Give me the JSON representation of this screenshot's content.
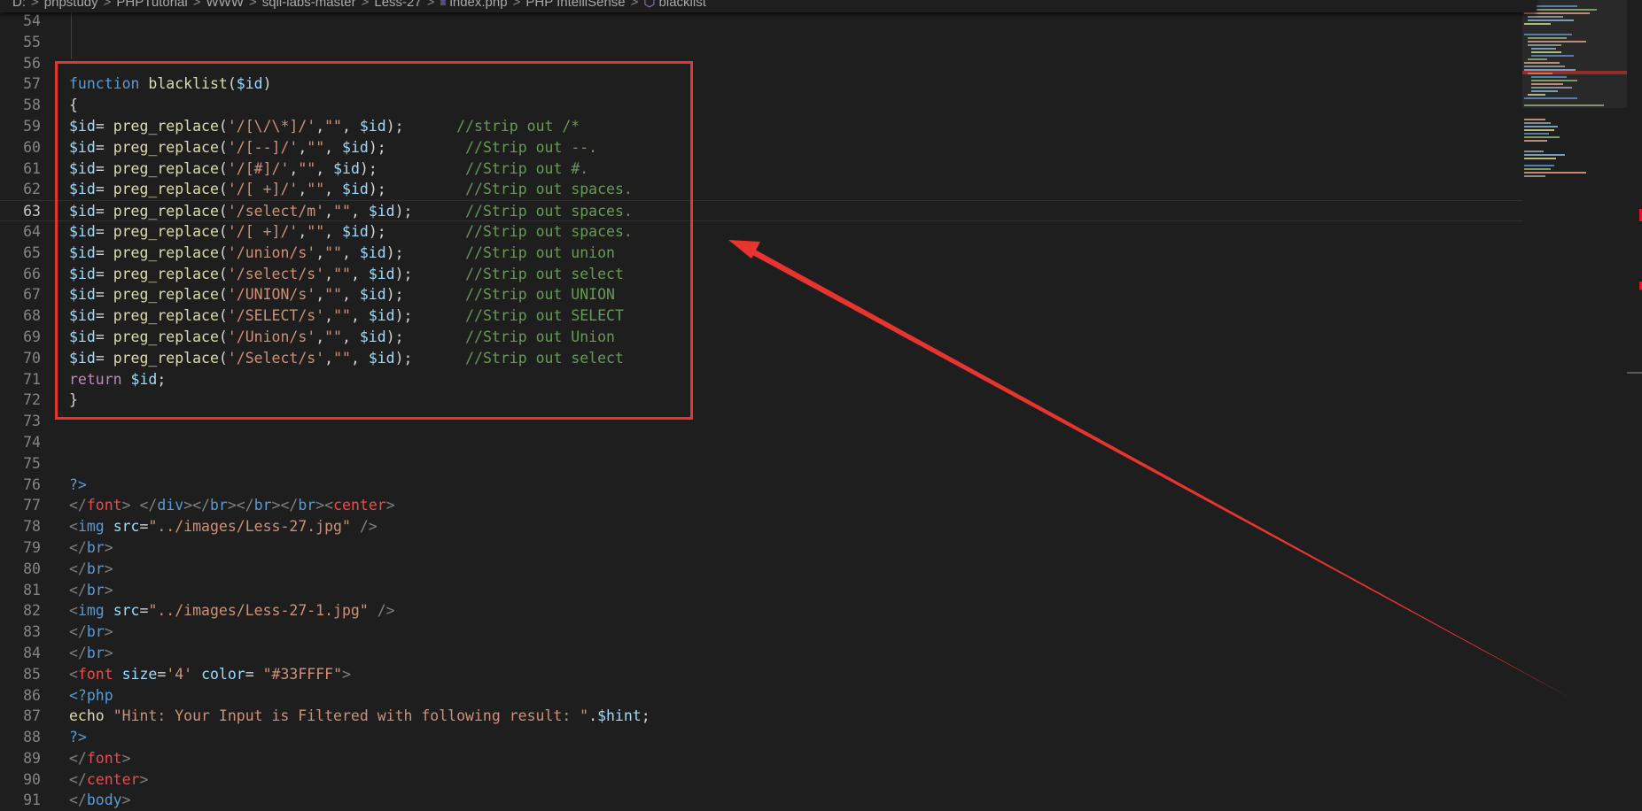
{
  "breadcrumb": {
    "items": [
      "D:",
      "phpstudy",
      "PHPTutorial",
      "WWW",
      "sqli-labs-master",
      "Less-27",
      "index.php",
      "PHP IntelliSense",
      "blacklist"
    ],
    "separator": ">"
  },
  "editor": {
    "current_line": 63,
    "lines": [
      {
        "n": "54",
        "t": []
      },
      {
        "n": "55",
        "t": []
      },
      {
        "n": "56",
        "t": []
      },
      {
        "n": "57",
        "t": [
          [
            "kw",
            "function"
          ],
          [
            "punc",
            " "
          ],
          [
            "fn",
            "blacklist"
          ],
          [
            "punc",
            "("
          ],
          [
            "var",
            "$id"
          ],
          [
            "punc",
            ")"
          ]
        ]
      },
      {
        "n": "58",
        "t": [
          [
            "punc",
            "{"
          ]
        ]
      },
      {
        "n": "59",
        "t": [
          [
            "var",
            "$id"
          ],
          [
            "punc",
            "= "
          ],
          [
            "fn",
            "preg_replace"
          ],
          [
            "punc",
            "("
          ],
          [
            "str",
            "'/[\\/\\*]/'"
          ],
          [
            "punc",
            ","
          ],
          [
            "str",
            "\"\""
          ],
          [
            "punc",
            ", "
          ],
          [
            "var",
            "$id"
          ],
          [
            "punc",
            ");      "
          ],
          [
            "cmt",
            "//strip out /*"
          ]
        ]
      },
      {
        "n": "60",
        "t": [
          [
            "var",
            "$id"
          ],
          [
            "punc",
            "= "
          ],
          [
            "fn",
            "preg_replace"
          ],
          [
            "punc",
            "("
          ],
          [
            "str",
            "'/[--]/'"
          ],
          [
            "punc",
            ","
          ],
          [
            "str",
            "\"\""
          ],
          [
            "punc",
            ", "
          ],
          [
            "var",
            "$id"
          ],
          [
            "punc",
            ");         "
          ],
          [
            "cmt",
            "//Strip out --."
          ]
        ]
      },
      {
        "n": "61",
        "t": [
          [
            "var",
            "$id"
          ],
          [
            "punc",
            "= "
          ],
          [
            "fn",
            "preg_replace"
          ],
          [
            "punc",
            "("
          ],
          [
            "str",
            "'/[#]/'"
          ],
          [
            "punc",
            ","
          ],
          [
            "str",
            "\"\""
          ],
          [
            "punc",
            ", "
          ],
          [
            "var",
            "$id"
          ],
          [
            "punc",
            ");          "
          ],
          [
            "cmt",
            "//Strip out #."
          ]
        ]
      },
      {
        "n": "62",
        "t": [
          [
            "var",
            "$id"
          ],
          [
            "punc",
            "= "
          ],
          [
            "fn",
            "preg_replace"
          ],
          [
            "punc",
            "("
          ],
          [
            "str",
            "'/[ +]/'"
          ],
          [
            "punc",
            ","
          ],
          [
            "str",
            "\"\""
          ],
          [
            "punc",
            ", "
          ],
          [
            "var",
            "$id"
          ],
          [
            "punc",
            ");         "
          ],
          [
            "cmt",
            "//Strip out spaces."
          ]
        ]
      },
      {
        "n": "63",
        "t": [
          [
            "var",
            "$id"
          ],
          [
            "punc",
            "= "
          ],
          [
            "fn",
            "preg_replace"
          ],
          [
            "punc",
            "("
          ],
          [
            "str",
            "'/select/m'"
          ],
          [
            "punc",
            ","
          ],
          [
            "str",
            "\"\""
          ],
          [
            "punc",
            ", "
          ],
          [
            "var",
            "$id"
          ],
          [
            "punc",
            ");      "
          ],
          [
            "cmt",
            "//Strip out spaces."
          ]
        ]
      },
      {
        "n": "64",
        "t": [
          [
            "var",
            "$id"
          ],
          [
            "punc",
            "= "
          ],
          [
            "fn",
            "preg_replace"
          ],
          [
            "punc",
            "("
          ],
          [
            "str",
            "'/[ +]/'"
          ],
          [
            "punc",
            ","
          ],
          [
            "str",
            "\"\""
          ],
          [
            "punc",
            ", "
          ],
          [
            "var",
            "$id"
          ],
          [
            "punc",
            ");         "
          ],
          [
            "cmt",
            "//Strip out spaces."
          ]
        ]
      },
      {
        "n": "65",
        "t": [
          [
            "var",
            "$id"
          ],
          [
            "punc",
            "= "
          ],
          [
            "fn",
            "preg_replace"
          ],
          [
            "punc",
            "("
          ],
          [
            "str",
            "'/union/s'"
          ],
          [
            "punc",
            ","
          ],
          [
            "str",
            "\"\""
          ],
          [
            "punc",
            ", "
          ],
          [
            "var",
            "$id"
          ],
          [
            "punc",
            ");       "
          ],
          [
            "cmt",
            "//Strip out union"
          ]
        ]
      },
      {
        "n": "66",
        "t": [
          [
            "var",
            "$id"
          ],
          [
            "punc",
            "= "
          ],
          [
            "fn",
            "preg_replace"
          ],
          [
            "punc",
            "("
          ],
          [
            "str",
            "'/select/s'"
          ],
          [
            "punc",
            ","
          ],
          [
            "str",
            "\"\""
          ],
          [
            "punc",
            ", "
          ],
          [
            "var",
            "$id"
          ],
          [
            "punc",
            ");      "
          ],
          [
            "cmt",
            "//Strip out select"
          ]
        ]
      },
      {
        "n": "67",
        "t": [
          [
            "var",
            "$id"
          ],
          [
            "punc",
            "= "
          ],
          [
            "fn",
            "preg_replace"
          ],
          [
            "punc",
            "("
          ],
          [
            "str",
            "'/UNION/s'"
          ],
          [
            "punc",
            ","
          ],
          [
            "str",
            "\"\""
          ],
          [
            "punc",
            ", "
          ],
          [
            "var",
            "$id"
          ],
          [
            "punc",
            ");       "
          ],
          [
            "cmt",
            "//Strip out UNION"
          ]
        ]
      },
      {
        "n": "68",
        "t": [
          [
            "var",
            "$id"
          ],
          [
            "punc",
            "= "
          ],
          [
            "fn",
            "preg_replace"
          ],
          [
            "punc",
            "("
          ],
          [
            "str",
            "'/SELECT/s'"
          ],
          [
            "punc",
            ","
          ],
          [
            "str",
            "\"\""
          ],
          [
            "punc",
            ", "
          ],
          [
            "var",
            "$id"
          ],
          [
            "punc",
            ");      "
          ],
          [
            "cmt",
            "//Strip out SELECT"
          ]
        ]
      },
      {
        "n": "69",
        "t": [
          [
            "var",
            "$id"
          ],
          [
            "punc",
            "= "
          ],
          [
            "fn",
            "preg_replace"
          ],
          [
            "punc",
            "("
          ],
          [
            "str",
            "'/Union/s'"
          ],
          [
            "punc",
            ","
          ],
          [
            "str",
            "\"\""
          ],
          [
            "punc",
            ", "
          ],
          [
            "var",
            "$id"
          ],
          [
            "punc",
            ");       "
          ],
          [
            "cmt",
            "//Strip out Union"
          ]
        ]
      },
      {
        "n": "70",
        "t": [
          [
            "var",
            "$id"
          ],
          [
            "punc",
            "= "
          ],
          [
            "fn",
            "preg_replace"
          ],
          [
            "punc",
            "("
          ],
          [
            "str",
            "'/Select/s'"
          ],
          [
            "punc",
            ","
          ],
          [
            "str",
            "\"\""
          ],
          [
            "punc",
            ", "
          ],
          [
            "var",
            "$id"
          ],
          [
            "punc",
            ");      "
          ],
          [
            "cmt",
            "//Strip out select"
          ]
        ]
      },
      {
        "n": "71",
        "t": [
          [
            "ctl",
            "return"
          ],
          [
            "punc",
            " "
          ],
          [
            "var",
            "$id"
          ],
          [
            "punc",
            ";"
          ]
        ]
      },
      {
        "n": "72",
        "t": [
          [
            "punc",
            "}"
          ]
        ]
      },
      {
        "n": "73",
        "t": []
      },
      {
        "n": "74",
        "t": []
      },
      {
        "n": "75",
        "t": []
      },
      {
        "n": "76",
        "t": [
          [
            "phptag",
            "?>"
          ]
        ]
      },
      {
        "n": "77",
        "t": [
          [
            "delim",
            "</"
          ],
          [
            "tname",
            "font"
          ],
          [
            "delim",
            ">"
          ],
          [
            "punc",
            " "
          ],
          [
            "delim",
            "</"
          ],
          [
            "tname2",
            "div"
          ],
          [
            "delim",
            "></"
          ],
          [
            "tname2",
            "br"
          ],
          [
            "delim",
            "></"
          ],
          [
            "tname2",
            "br"
          ],
          [
            "delim",
            "></"
          ],
          [
            "tname2",
            "br"
          ],
          [
            "delim",
            "><"
          ],
          [
            "tname",
            "center"
          ],
          [
            "delim",
            ">"
          ]
        ]
      },
      {
        "n": "78",
        "t": [
          [
            "delim",
            "<"
          ],
          [
            "tname2",
            "img"
          ],
          [
            "punc",
            " "
          ],
          [
            "attr",
            "src"
          ],
          [
            "punc",
            "="
          ],
          [
            "str",
            "\"../images/Less-27.jpg\""
          ],
          [
            "punc",
            " "
          ],
          [
            "delim",
            "/>"
          ]
        ]
      },
      {
        "n": "79",
        "t": [
          [
            "delim",
            "</"
          ],
          [
            "tname2",
            "br"
          ],
          [
            "delim",
            ">"
          ]
        ]
      },
      {
        "n": "80",
        "t": [
          [
            "delim",
            "</"
          ],
          [
            "tname2",
            "br"
          ],
          [
            "delim",
            ">"
          ]
        ]
      },
      {
        "n": "81",
        "t": [
          [
            "delim",
            "</"
          ],
          [
            "tname2",
            "br"
          ],
          [
            "delim",
            ">"
          ]
        ]
      },
      {
        "n": "82",
        "t": [
          [
            "delim",
            "<"
          ],
          [
            "tname2",
            "img"
          ],
          [
            "punc",
            " "
          ],
          [
            "attr",
            "src"
          ],
          [
            "punc",
            "="
          ],
          [
            "str",
            "\"../images/Less-27-1.jpg\""
          ],
          [
            "punc",
            " "
          ],
          [
            "delim",
            "/>"
          ]
        ]
      },
      {
        "n": "83",
        "t": [
          [
            "delim",
            "</"
          ],
          [
            "tname2",
            "br"
          ],
          [
            "delim",
            ">"
          ]
        ]
      },
      {
        "n": "84",
        "t": [
          [
            "delim",
            "</"
          ],
          [
            "tname2",
            "br"
          ],
          [
            "delim",
            ">"
          ]
        ]
      },
      {
        "n": "85",
        "t": [
          [
            "delim",
            "<"
          ],
          [
            "tname",
            "font"
          ],
          [
            "punc",
            " "
          ],
          [
            "attr",
            "size"
          ],
          [
            "punc",
            "="
          ],
          [
            "str",
            "'4'"
          ],
          [
            "punc",
            " "
          ],
          [
            "attr",
            "color"
          ],
          [
            "punc",
            "= "
          ],
          [
            "str",
            "\"#33FFFF\""
          ],
          [
            "delim",
            ">"
          ]
        ]
      },
      {
        "n": "86",
        "t": [
          [
            "phptag",
            "<?php"
          ]
        ]
      },
      {
        "n": "87",
        "t": [
          [
            "fn",
            "echo"
          ],
          [
            "punc",
            " "
          ],
          [
            "str",
            "\"Hint: Your Input is Filtered with following result: \""
          ],
          [
            "punc",
            "."
          ],
          [
            "var",
            "$hint"
          ],
          [
            "punc",
            ";"
          ]
        ]
      },
      {
        "n": "88",
        "t": [
          [
            "phptag",
            "?>"
          ]
        ]
      },
      {
        "n": "89",
        "t": [
          [
            "delim",
            "</"
          ],
          [
            "tname",
            "font"
          ],
          [
            "delim",
            ">"
          ]
        ]
      },
      {
        "n": "90",
        "t": [
          [
            "delim",
            "</"
          ],
          [
            "tname",
            "center"
          ],
          [
            "delim",
            ">"
          ]
        ]
      },
      {
        "n": "91",
        "t": [
          [
            "delim",
            "</"
          ],
          [
            "tname2",
            "body"
          ],
          [
            "delim",
            ">"
          ]
        ]
      }
    ]
  },
  "annotation": {
    "box_color": "#e8342f",
    "arrow_color": "#e8342f"
  },
  "icons": {
    "php_file_icon": "php-file-icon",
    "symbol_icon": "method-symbol-icon"
  }
}
